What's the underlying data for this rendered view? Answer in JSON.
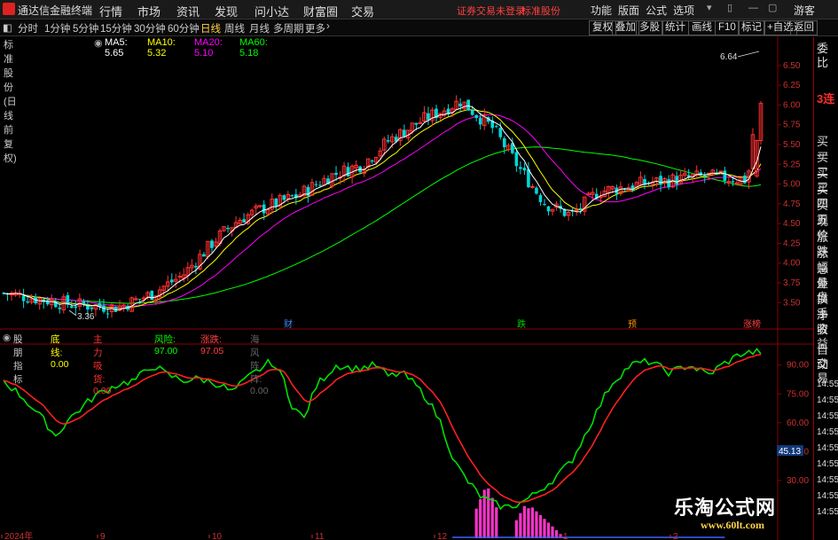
{
  "app": {
    "name": "通达信金融终端",
    "menus": [
      "行情",
      "市场",
      "资讯",
      "发现",
      "问小达",
      "财富圈",
      "交易"
    ],
    "notice": "证券交易未登录",
    "stock_tab": "标准股份",
    "right_menus": [
      "功能",
      "版面",
      "公式",
      "选项"
    ],
    "guest": "游客"
  },
  "toolbar": {
    "periods": [
      "分时",
      "1分钟",
      "5分钟",
      "15分钟",
      "30分钟",
      "60分钟",
      "日线",
      "周线",
      "月线",
      "多周期",
      "更多"
    ],
    "active_period": "日线",
    "right_buttons": [
      "复权",
      "叠加",
      "多股",
      "统计",
      "画线",
      "F10",
      "标记",
      "+自选",
      "返回"
    ]
  },
  "main_chart": {
    "title": "标准股份(日线 前复权)",
    "ma": [
      {
        "label": "MA5: 5.65",
        "color": "#ffffff"
      },
      {
        "label": "MA10: 5.32",
        "color": "#ffff00"
      },
      {
        "label": "MA20: 5.10",
        "color": "#ff00ff"
      },
      {
        "label": "MA60: 5.18",
        "color": "#00ff00"
      }
    ],
    "price_ticks": [
      "6.50",
      "6.25",
      "6.00",
      "5.75",
      "5.50",
      "5.25",
      "5.00",
      "4.75",
      "4.50",
      "4.25",
      "4.00",
      "3.75",
      "3.50"
    ],
    "high_label": "6.64",
    "low_label": "3.36",
    "event_tags": [
      {
        "text": "财",
        "color": "#3a8cff"
      },
      {
        "text": "跌",
        "color": "#00d000"
      },
      {
        "text": "预",
        "color": "#ff9000"
      },
      {
        "text": "涨榜",
        "color": "#ff4040"
      }
    ]
  },
  "indicator": {
    "name": "股朋指标",
    "items": [
      {
        "label": "底线: 0.00",
        "color": "#ffff00"
      },
      {
        "label": "主力吸货: 0.00",
        "color": "#ff3030"
      },
      {
        "label": "风险: 97.00",
        "color": "#00ff00"
      },
      {
        "label": "涨跌: 97.05",
        "color": "#ff4040"
      },
      {
        "label": "海风阵阵: 0.00",
        "color": "#666666"
      }
    ],
    "ticks": [
      "90.00",
      "75.00",
      "60.00",
      "45.00",
      "30.00"
    ],
    "current_value": "45.13"
  },
  "x_axis": [
    "2024年",
    "9",
    "10",
    "11",
    "12",
    "1",
    "2"
  ],
  "right_panel": {
    "items": [
      "委比",
      "3连",
      "买一",
      "买二",
      "买三",
      "买四",
      "买五",
      "现价",
      "涨跌",
      "涨幅",
      "总量",
      "外盘",
      "换手",
      "净资",
      "收益",
      "自动",
      "交易"
    ],
    "times": [
      "14:55",
      "14:55",
      "14:55",
      "14:55",
      "14:55",
      "14:55",
      "14:55",
      "14:55",
      "14:55"
    ]
  },
  "watermark": {
    "title": "乐淘公式网",
    "url": "www.60lt.com"
  },
  "colors": {
    "up": "#ff3030",
    "down": "#00d8d8",
    "ma5": "#ffffff",
    "ma10": "#ffff00",
    "ma20": "#ff00ff",
    "ma60": "#00ff00"
  }
}
